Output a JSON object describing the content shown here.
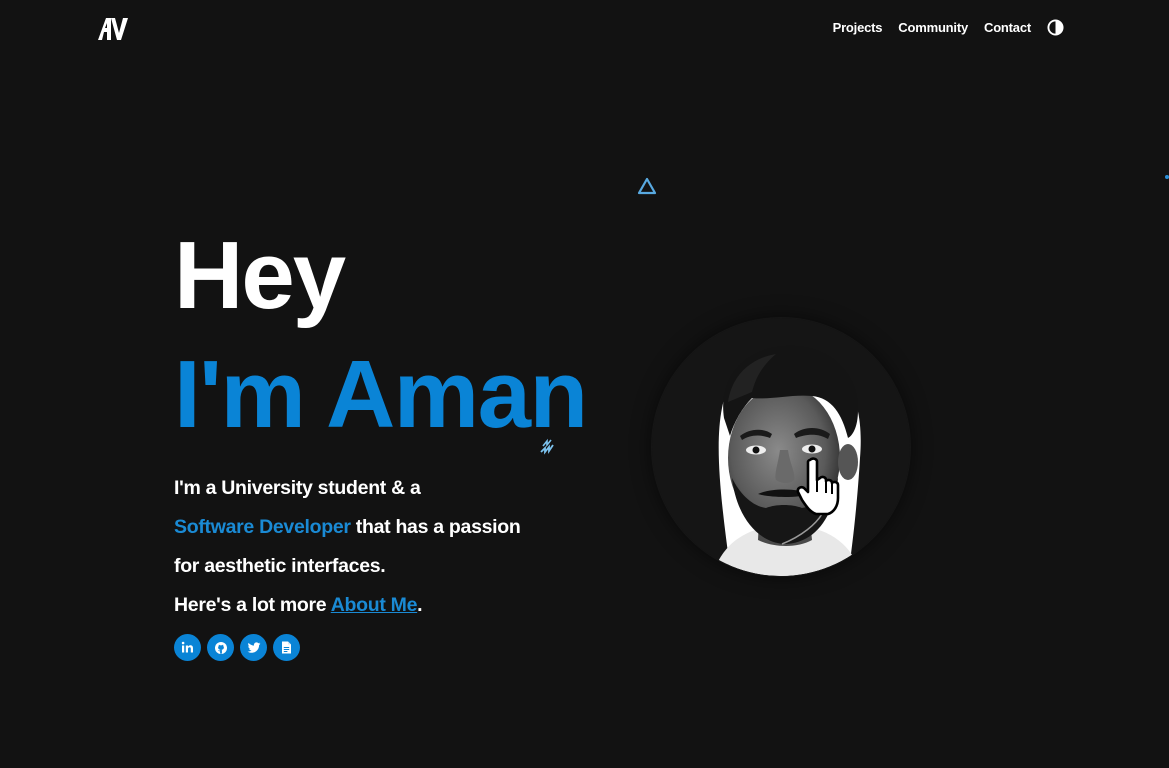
{
  "header": {
    "logo_alt": "AV",
    "nav": [
      {
        "label": "Projects"
      },
      {
        "label": "Community"
      },
      {
        "label": "Contact"
      }
    ],
    "theme_toggle_icon": "half-circle-contrast-icon"
  },
  "hero": {
    "greeting": "Hey",
    "name": "I'm Aman",
    "bio": {
      "line1": "I'm a University student & a",
      "line2_accent": "Software Developer",
      "line2_rest": " that has a passion",
      "line3": "for aesthetic interfaces.",
      "line4_prefix": "Here's a lot more ",
      "line4_link": "About Me",
      "line4_suffix": "."
    }
  },
  "socials": [
    {
      "icon": "linkedin-icon"
    },
    {
      "icon": "github-icon"
    },
    {
      "icon": "twitter-icon"
    },
    {
      "icon": "document-icon"
    }
  ],
  "colors": {
    "background": "#121212",
    "accent": "#0a84d6",
    "text": "#ffffff"
  }
}
